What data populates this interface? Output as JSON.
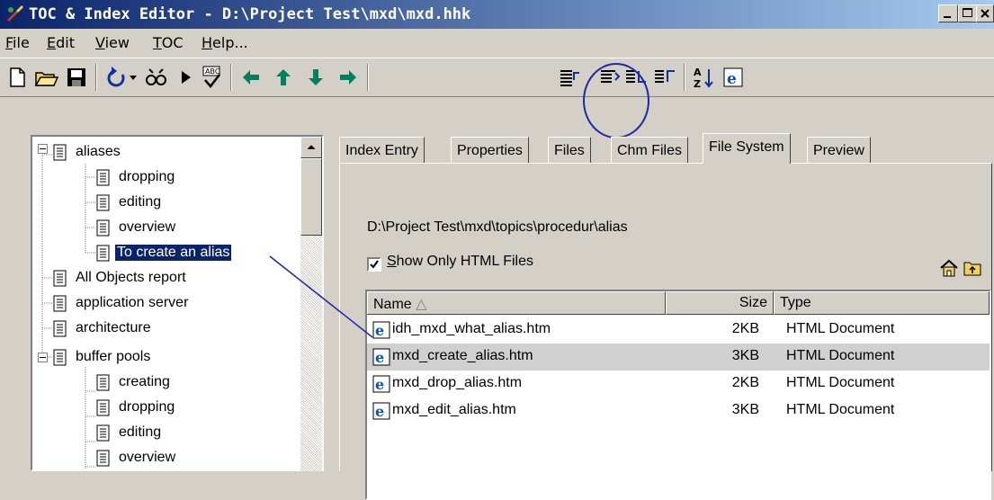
{
  "window": {
    "title": "TOC & Index Editor - D:\\Project Test\\mxd\\mxd.hhk"
  },
  "menu": [
    {
      "label_pre": "",
      "label_ul": "F",
      "label_post": "ile"
    },
    {
      "label_pre": "",
      "label_ul": "E",
      "label_post": "dit"
    },
    {
      "label_pre": "",
      "label_ul": "V",
      "label_post": "iew"
    },
    {
      "label_pre": "",
      "label_ul": "T",
      "label_post": "OC"
    },
    {
      "label_pre": "",
      "label_ul": "H",
      "label_post": "elp..."
    }
  ],
  "toolbar": {
    "icons": [
      "new-icon",
      "open-icon",
      "save-icon",
      "undo-icon",
      "undo-dropdown-icon",
      "find-icon",
      "run-icon",
      "spellcheck-icon",
      "move-left-icon",
      "move-up-icon",
      "move-down-icon",
      "move-right-icon",
      "insert-before-icon",
      "insert-after-icon",
      "insert-child-icon",
      "insert-sibling-icon",
      "sort-icon",
      "browser-icon"
    ]
  },
  "tree": {
    "items": [
      {
        "label": "aliases",
        "level": 0,
        "expanded": true
      },
      {
        "label": "dropping",
        "level": 1
      },
      {
        "label": "editing",
        "level": 1
      },
      {
        "label": "overview",
        "level": 1
      },
      {
        "label": "To create an alias",
        "level": 1,
        "selected": true
      },
      {
        "label": "All Objects report",
        "level": 0
      },
      {
        "label": "application server",
        "level": 0
      },
      {
        "label": "architecture",
        "level": 0
      },
      {
        "label": "buffer pools",
        "level": 0,
        "expanded": true
      },
      {
        "label": "creating",
        "level": 1
      },
      {
        "label": "dropping",
        "level": 1
      },
      {
        "label": "editing",
        "level": 1
      },
      {
        "label": "overview",
        "level": 1
      }
    ]
  },
  "tabs": [
    {
      "label": "Index Entry"
    },
    {
      "label": "Properties"
    },
    {
      "label": "Files"
    },
    {
      "label": "Chm Files"
    },
    {
      "label": "File System",
      "active": true
    },
    {
      "label": "Preview"
    }
  ],
  "file_system": {
    "path": "D:\\Project Test\\mxd\\topics\\procedur\\alias",
    "show_only_html": {
      "checked": true,
      "label_ul": "S",
      "label_post": "how Only HTML Files"
    },
    "columns": {
      "name": "Name",
      "sort_glyph": "△",
      "size": "Size",
      "type": "Type"
    },
    "files": [
      {
        "name": "idh_mxd_what_alias.htm",
        "size": "2KB",
        "type": "HTML Document"
      },
      {
        "name": "mxd_create_alias.htm",
        "size": "3KB",
        "type": "HTML Document",
        "selected": true
      },
      {
        "name": "mxd_drop_alias.htm",
        "size": "2KB",
        "type": "HTML Document"
      },
      {
        "name": "mxd_edit_alias.htm",
        "size": "3KB",
        "type": "HTML Document"
      }
    ]
  },
  "colors": {
    "titlebar_start": "#0a246a",
    "titlebar_end": "#a6caf0",
    "highlight": "#0a246a",
    "annotation": "#1a2aa8"
  }
}
